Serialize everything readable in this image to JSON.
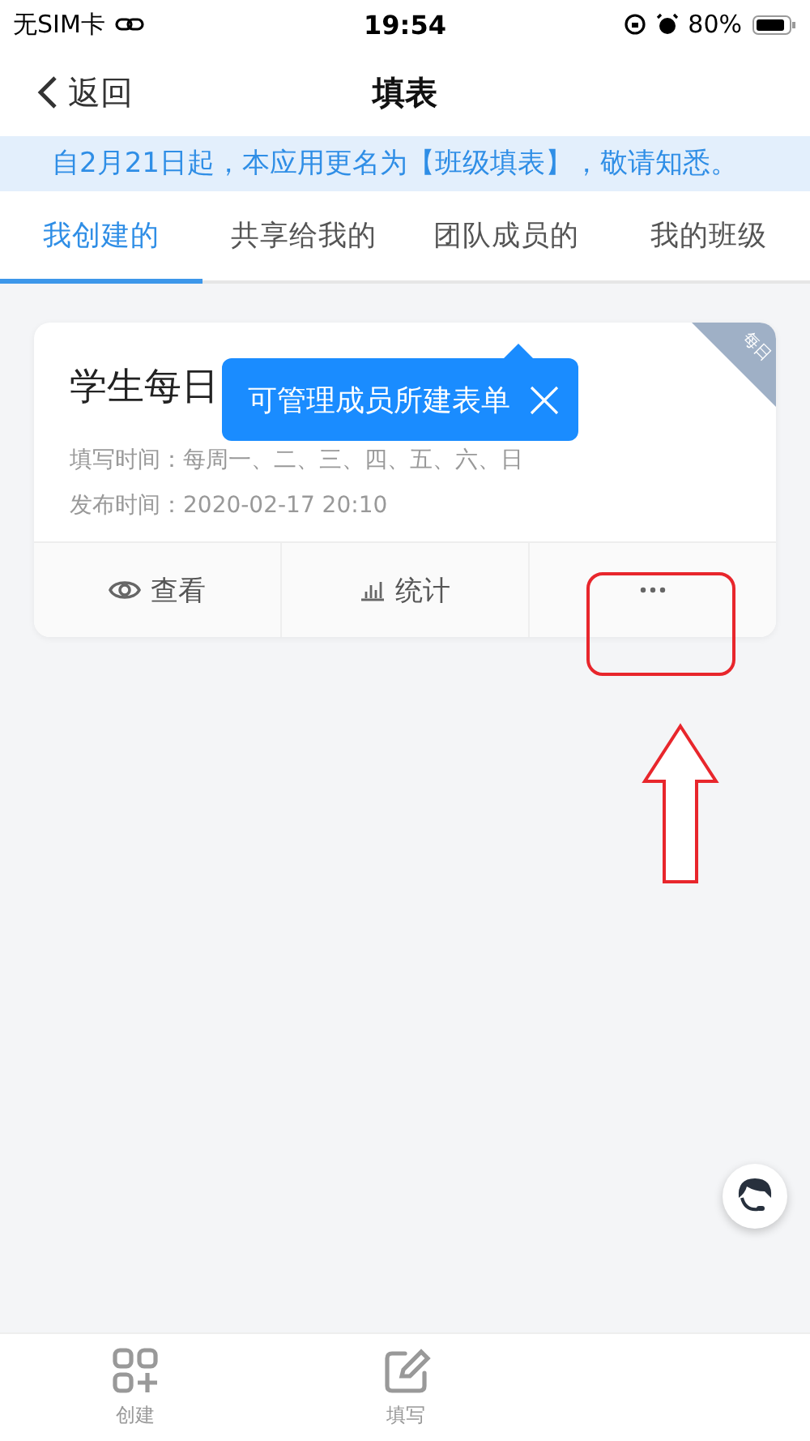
{
  "status_bar": {
    "carrier": "无SIM卡",
    "time": "19:54",
    "battery": "80%"
  },
  "nav": {
    "back": "返回",
    "title": "填表"
  },
  "notice": "自2月21日起，本应用更名为【班级填表】，敬请知悉。",
  "tabs": [
    {
      "label": "我创建的",
      "selected": true
    },
    {
      "label": "共享给我的",
      "selected": false
    },
    {
      "label": "团队成员的",
      "selected": false
    },
    {
      "label": "我的班级",
      "selected": false
    }
  ],
  "tooltip": {
    "text": "可管理成员所建表单"
  },
  "card": {
    "title": "学生每日",
    "ribbon": "每日",
    "fill_time": "填写时间：每周一、二、三、四、五、六、日",
    "publish_time": "发布时间：2020-02-17 20:10",
    "actions": [
      {
        "kind": "view",
        "label": "查看"
      },
      {
        "kind": "stats",
        "label": "统计"
      },
      {
        "kind": "more"
      }
    ]
  },
  "bottom_tabs": [
    {
      "kind": "create",
      "label": "创建"
    },
    {
      "kind": "fill",
      "label": "填写"
    }
  ]
}
